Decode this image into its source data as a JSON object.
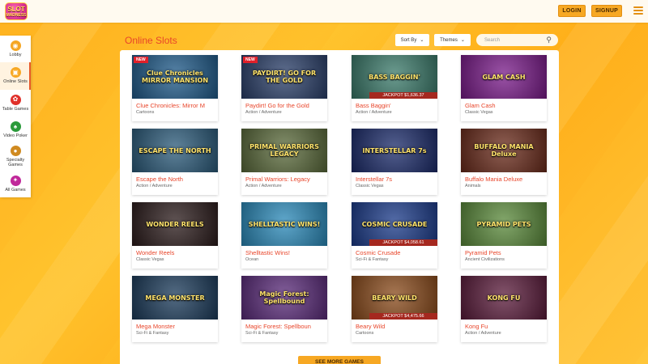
{
  "header": {
    "logo_line1": "SLOT",
    "logo_line2": "MADNESS",
    "login_label": "LOGIN",
    "signup_label": "SIGNUP"
  },
  "sidenav": {
    "items": [
      {
        "label": "Lobby",
        "icon": "lobby-icon",
        "color": "#f5a623"
      },
      {
        "label": "Online Slots",
        "icon": "slots-icon",
        "color": "#f7a823"
      },
      {
        "label": "Table Games",
        "icon": "table-games-icon",
        "color": "#e0302a"
      },
      {
        "label": "Video Poker",
        "icon": "video-poker-icon",
        "color": "#2a9a3a"
      },
      {
        "label": "Specialty Games",
        "icon": "specialty-icon",
        "color": "#d08a20"
      },
      {
        "label": "All Games",
        "icon": "all-games-icon",
        "color": "#c0289a"
      }
    ],
    "active": "Online Slots"
  },
  "main": {
    "title": "Online Slots",
    "sort_label": "Sort By",
    "themes_label": "Themes",
    "search_placeholder": "Search",
    "more_label": "SEE MORE GAMES"
  },
  "games": [
    {
      "title": "Clue Chronicles: Mirror M",
      "category": "Cartoons",
      "art": "Clue Chronicles MIRROR MANSION",
      "badge": "NEW",
      "jackpot": "",
      "bg": "#1e5a8a"
    },
    {
      "title": "Paydirt! Go for the Gold",
      "category": "Action / Adventure",
      "art": "PAYDIRT! GO FOR THE GOLD",
      "badge": "NEW",
      "jackpot": "",
      "bg": "#2a3f6a"
    },
    {
      "title": "Bass Baggin'",
      "category": "Action / Adventure",
      "art": "BASS BAGGIN'",
      "badge": "",
      "jackpot": "JACKPOT $1,636.37",
      "bg": "#3a7a6a"
    },
    {
      "title": "Glam Cash",
      "category": "Classic Vegas",
      "art": "GLAM CASH",
      "badge": "",
      "jackpot": "",
      "bg": "#7a1a8a"
    },
    {
      "title": "Escape the North",
      "category": "Action / Adventure",
      "art": "ESCAPE THE NORTH",
      "badge": "",
      "jackpot": "",
      "bg": "#2a5a7a"
    },
    {
      "title": "Primal Warriors: Legacy",
      "category": "Action / Adventure",
      "art": "PRIMAL WARRIORS LEGACY",
      "badge": "",
      "jackpot": "",
      "bg": "#5a6a3a"
    },
    {
      "title": "Interstellar 7s",
      "category": "Classic Vegas",
      "art": "INTERSTELLAR 7s",
      "badge": "",
      "jackpot": "",
      "bg": "#1a2a6a"
    },
    {
      "title": "Buffalo Mania Deluxe",
      "category": "Animals",
      "art": "BUFFALO MANIA Deluxe",
      "badge": "",
      "jackpot": "",
      "bg": "#6a2a1a"
    },
    {
      "title": "Wonder Reels",
      "category": "Classic Vegas",
      "art": "WONDER REELS",
      "badge": "",
      "jackpot": "",
      "bg": "#2a1a1a"
    },
    {
      "title": "Shelltastic Wins!",
      "category": "Ocean",
      "art": "SHELLTASTIC WINS!",
      "badge": "",
      "jackpot": "",
      "bg": "#2a8aba"
    },
    {
      "title": "Cosmic Crusade",
      "category": "Sci-Fi & Fantasy",
      "art": "COSMIC CRUSADE",
      "badge": "",
      "jackpot": "JACKPOT $4,058.61",
      "bg": "#1a3a8a"
    },
    {
      "title": "Pyramid Pets",
      "category": "Ancient Civilizations",
      "art": "PYRAMID PETS",
      "badge": "",
      "jackpot": "",
      "bg": "#5a8a3a"
    },
    {
      "title": "Mega Monster",
      "category": "Sci-Fi & Fantasy",
      "art": "MEGA MONSTER",
      "badge": "",
      "jackpot": "",
      "bg": "#1a3a5a"
    },
    {
      "title": "Magic Forest: Spellboun",
      "category": "Sci-Fi & Fantasy",
      "art": "Magic Forest: Spellbound",
      "badge": "",
      "jackpot": "",
      "bg": "#5a2a7a"
    },
    {
      "title": "Beary Wild",
      "category": "Cartoons",
      "art": "BEARY WILD",
      "badge": "",
      "jackpot": "JACKPOT $4,475.66",
      "bg": "#8a4a1a"
    },
    {
      "title": "Kong Fu",
      "category": "Action / Adventure",
      "art": "KONG FU",
      "badge": "",
      "jackpot": "",
      "bg": "#5a1a3a"
    }
  ]
}
